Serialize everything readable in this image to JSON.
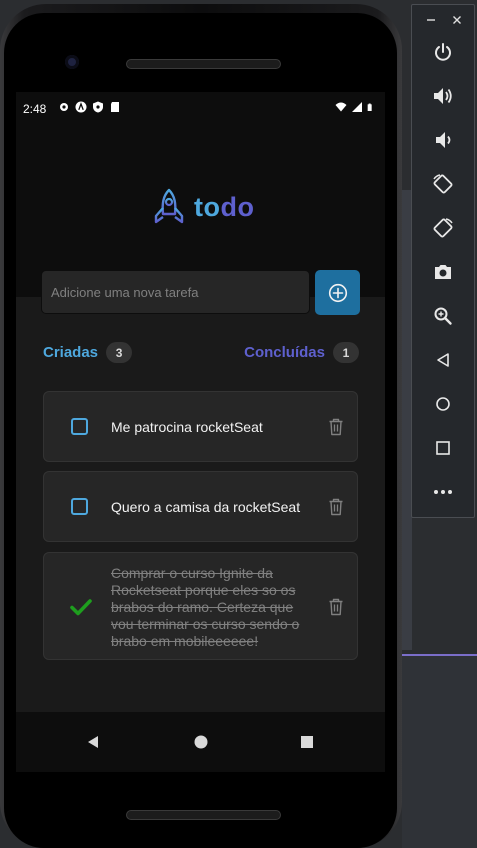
{
  "status_bar": {
    "time": "2:48"
  },
  "app": {
    "logo": {
      "part1": "to",
      "part2": "do"
    },
    "input": {
      "placeholder": "Adicione uma nova tarefa",
      "value": ""
    },
    "counters": {
      "created": {
        "label": "Criadas",
        "count": "3"
      },
      "done": {
        "label": "Concluídas",
        "count": "1"
      }
    },
    "tasks": [
      {
        "text": "Me patrocina rocketSeat",
        "done": false
      },
      {
        "text": "Quero a camisa da rocketSeat",
        "done": false
      },
      {
        "text": "Comprar o curso Ignite da Rocketseat porque eles so os brabos do ramo. Certeza que vou terminar os curso sendo o brabo em mobileeeeee!",
        "done": true
      }
    ]
  },
  "colors": {
    "blue": "#4ea8de",
    "purple": "#5e60ce",
    "button": "#1e6f9f",
    "card": "#262626",
    "check_green": "#1e9e1e"
  },
  "icons": {
    "logo": "rocket-icon",
    "add": "plus-circle-icon",
    "task_unchecked": "checkbox-icon",
    "task_checked": "check-icon",
    "delete": "trash-icon",
    "nav": [
      "back-icon",
      "home-icon",
      "recents-icon"
    ],
    "toolbar": [
      "minimize-icon",
      "close-icon",
      "power-icon",
      "volume-up-icon",
      "volume-down-icon",
      "rotate-left-icon",
      "rotate-right-icon",
      "camera-icon",
      "zoom-icon",
      "back-icon",
      "home-icon",
      "overview-icon",
      "more-icon"
    ]
  }
}
